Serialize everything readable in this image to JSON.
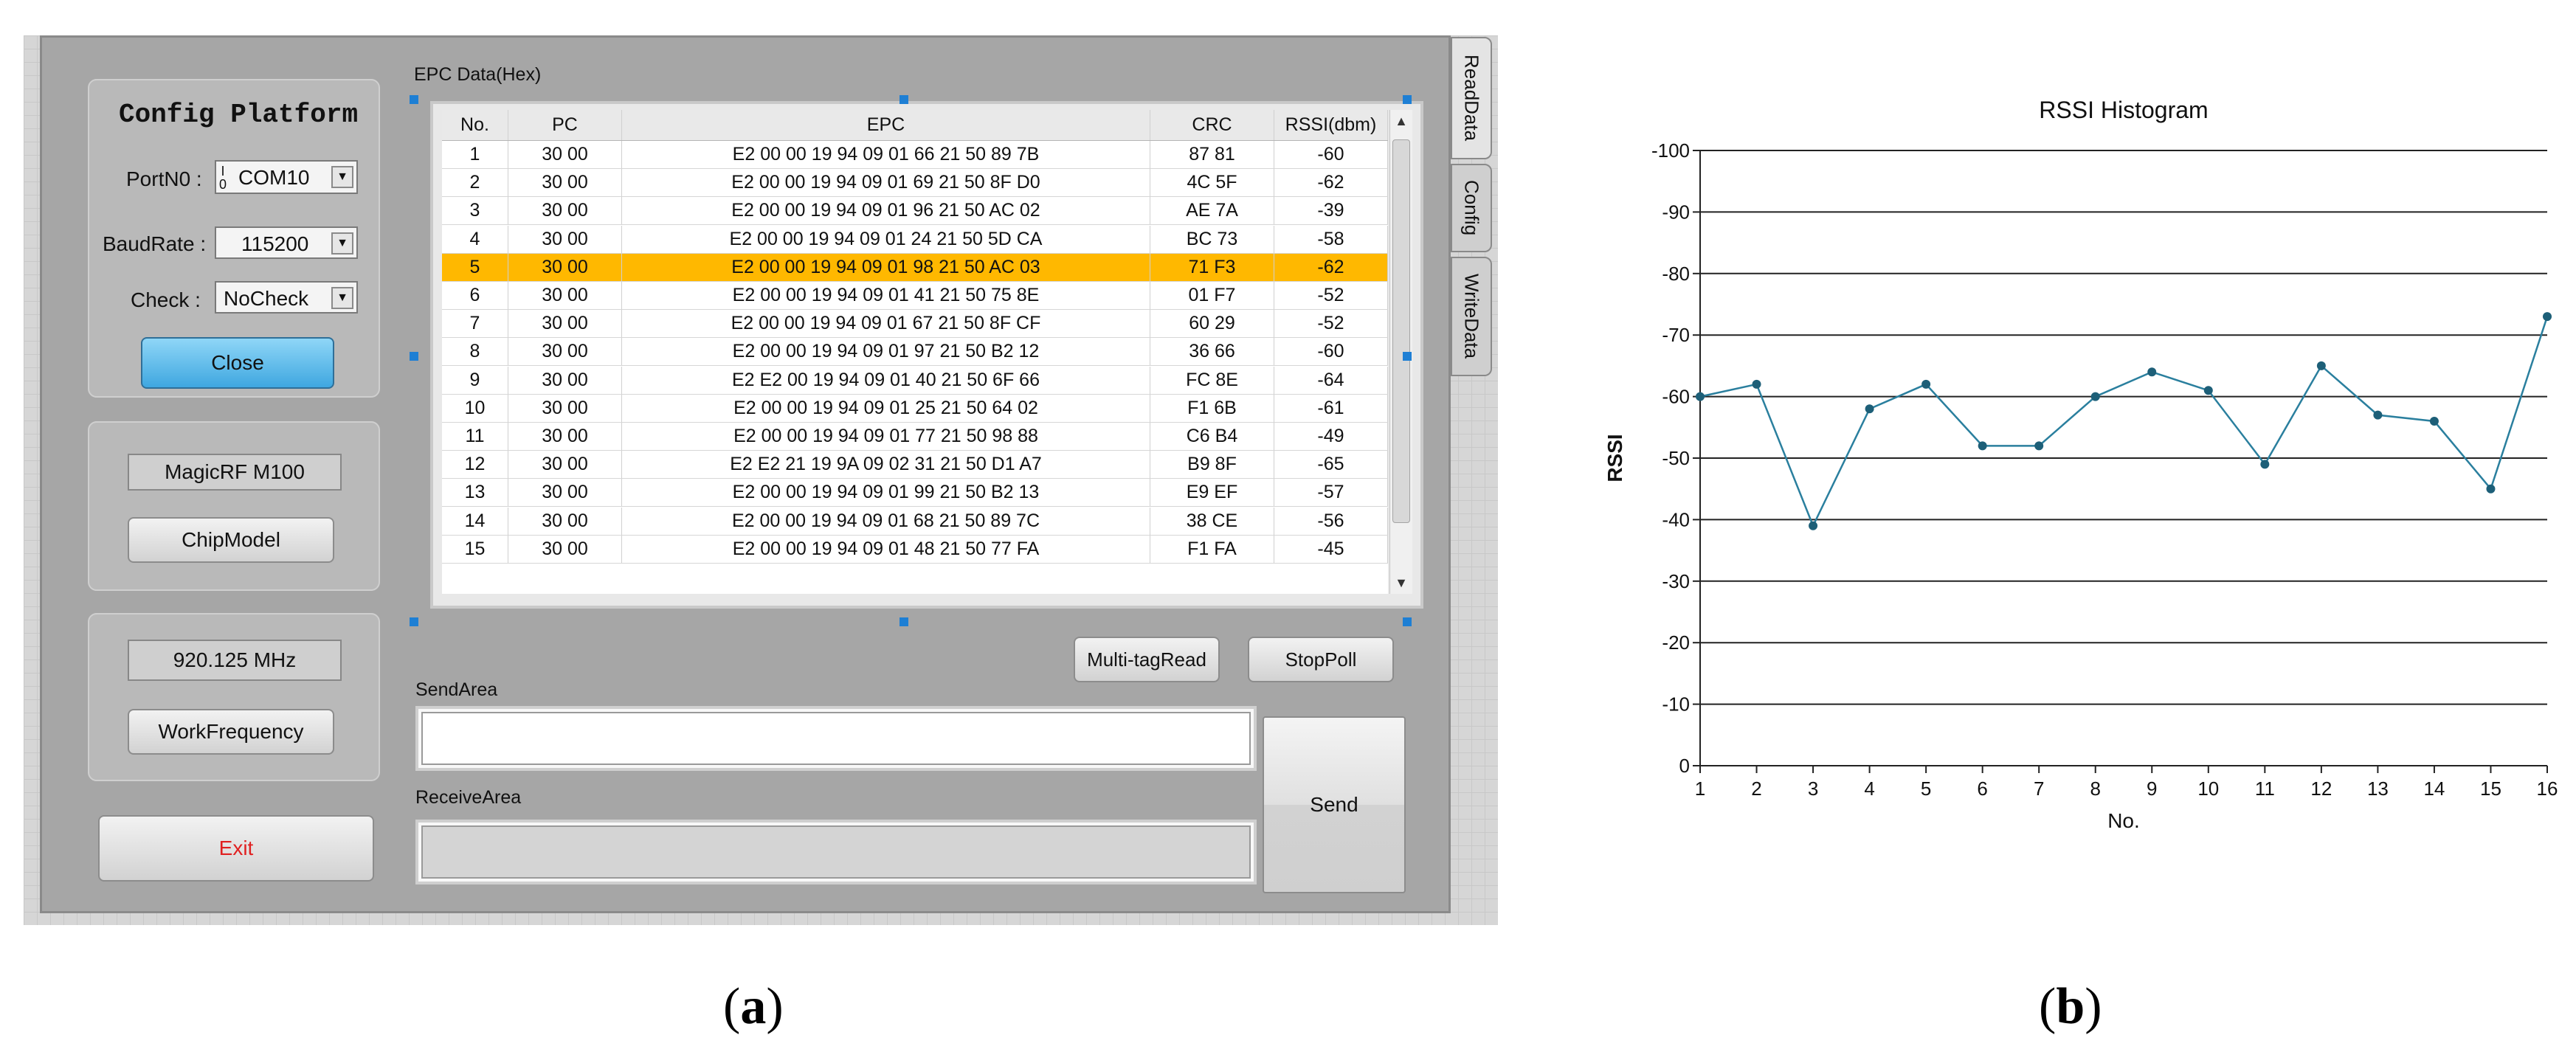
{
  "config": {
    "title": "Config Platform",
    "port_label": "PortN0 :",
    "port_prefix_icon": "io-icon",
    "port_value": "COM10",
    "baud_label": "BaudRate :",
    "baud_value": "115200",
    "check_label": "Check :",
    "check_value": "NoCheck",
    "close_label": "Close",
    "chip_display": "MagicRF M100",
    "chip_button": "ChipModel",
    "freq_display": "920.125 MHz",
    "freq_button": "WorkFrequency",
    "exit_label": "Exit"
  },
  "tabs": [
    "ReadData",
    "Config",
    "WriteData"
  ],
  "epc": {
    "label": "EPC Data(Hex)",
    "columns": [
      "No.",
      "PC",
      "EPC",
      "CRC",
      "RSSI(dbm)"
    ],
    "selected_row": 4,
    "rows": [
      [
        "1",
        "30 00",
        "E2 00 00 19 94 09 01 66 21 50 89 7B",
        "87 81",
        "-60"
      ],
      [
        "2",
        "30 00",
        "E2 00 00 19 94 09 01 69 21 50 8F D0",
        "4C 5F",
        "-62"
      ],
      [
        "3",
        "30 00",
        "E2 00 00 19 94 09 01 96 21 50 AC 02",
        "AE 7A",
        "-39"
      ],
      [
        "4",
        "30 00",
        "E2 00 00 19 94 09 01 24 21 50 5D CA",
        "BC 73",
        "-58"
      ],
      [
        "5",
        "30 00",
        "E2 00 00 19 94 09 01 98 21 50 AC 03",
        "71 F3",
        "-62"
      ],
      [
        "6",
        "30 00",
        "E2 00 00 19 94 09 01 41 21 50 75 8E",
        "01 F7",
        "-52"
      ],
      [
        "7",
        "30 00",
        "E2 00 00 19 94 09 01 67 21 50 8F CF",
        "60 29",
        "-52"
      ],
      [
        "8",
        "30 00",
        "E2 00 00 19 94 09 01 97 21 50 B2 12",
        "36 66",
        "-60"
      ],
      [
        "9",
        "30 00",
        "E2 E2 00 19 94 09 01 40 21 50 6F 66",
        "FC 8E",
        "-64"
      ],
      [
        "10",
        "30 00",
        "E2 00 00 19 94 09 01 25 21 50 64 02",
        "F1 6B",
        "-61"
      ],
      [
        "11",
        "30 00",
        "E2 00 00 19 94 09 01 77 21 50 98 88",
        "C6 B4",
        "-49"
      ],
      [
        "12",
        "30 00",
        "E2 E2 21 19 9A 09 02 31 21 50 D1 A7",
        "B9 8F",
        "-65"
      ],
      [
        "13",
        "30 00",
        "E2 00 00 19 94 09 01 99 21 50 B2 13",
        "E9 EF",
        "-57"
      ],
      [
        "14",
        "30 00",
        "E2 00 00 19 94 09 01 68 21 50 89 7C",
        "38 CE",
        "-56"
      ],
      [
        "15",
        "30 00",
        "E2 00 00 19 94 09 01 48 21 50 77 FA",
        "F1 FA",
        "-45"
      ]
    ]
  },
  "controls": {
    "multi_read": "Multi-tagRead",
    "stop_poll": "StopPoll",
    "send_area_label": "SendArea",
    "receive_area_label": "ReceiveArea",
    "send_button": "Send"
  },
  "captions": {
    "a": "a",
    "b": "b"
  },
  "colors": {
    "selected_row": "#ffb800",
    "close_button": "#3fa7e0",
    "exit_text": "#e02020",
    "series": "#2a7f9e"
  },
  "chart_data": {
    "type": "line",
    "title": "RSSI Histogram",
    "xlabel": "No.",
    "ylabel": "RSSI",
    "x": [
      1,
      2,
      3,
      4,
      5,
      6,
      7,
      8,
      9,
      10,
      11,
      12,
      13,
      14,
      15,
      16
    ],
    "series": [
      {
        "values": [
          -60,
          -62,
          -39,
          -58,
          -62,
          -52,
          -52,
          -60,
          -64,
          -61,
          -49,
          -65,
          -57,
          -56,
          -45,
          -73
        ]
      }
    ],
    "yticks": [
      "-100",
      "-90",
      "-80",
      "-70",
      "-60",
      "-50",
      "-40",
      "-30",
      "-20",
      "-10",
      "0"
    ],
    "xticks": [
      "1",
      "2",
      "3",
      "4",
      "5",
      "6",
      "7",
      "8",
      "9",
      "10",
      "11",
      "12",
      "13",
      "14",
      "15",
      "16"
    ],
    "ylim": [
      0,
      -100
    ],
    "y_axis_inverted": true,
    "grid": "horizontal"
  }
}
